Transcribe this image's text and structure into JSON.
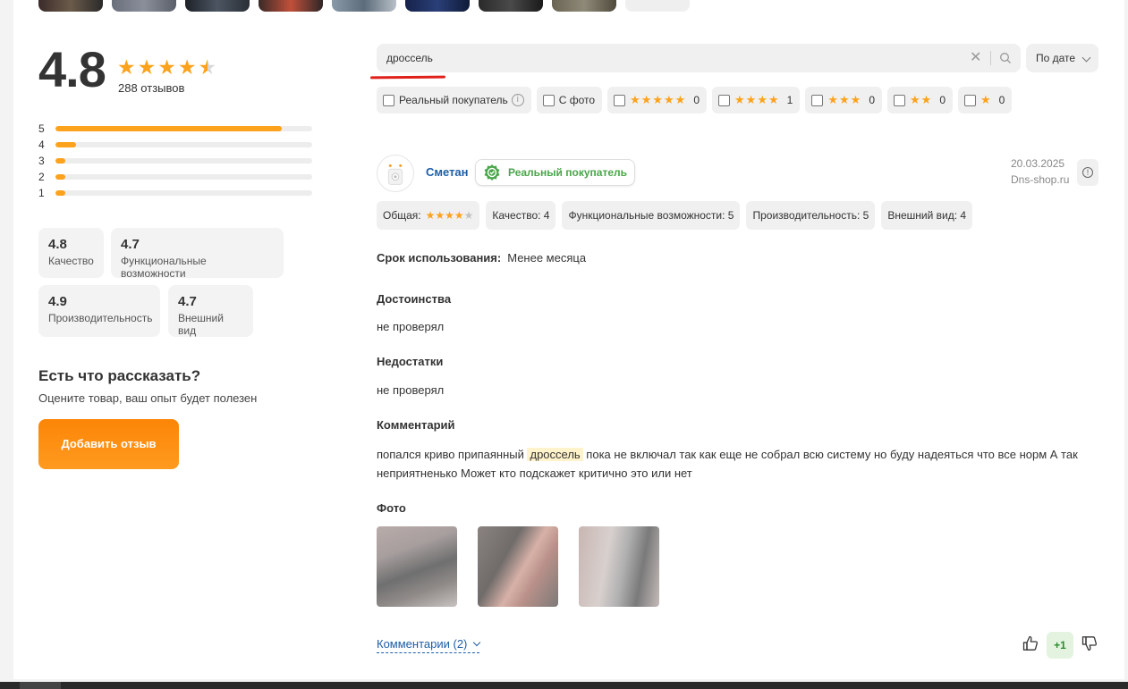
{
  "summary": {
    "average": "4.8",
    "stars_value": 4.8,
    "reviews_count": "288 отзывов",
    "distribution": [
      {
        "label": "5",
        "share": 0.88
      },
      {
        "label": "4",
        "share": 0.08
      },
      {
        "label": "3",
        "share": 0.04
      },
      {
        "label": "2",
        "share": 0.04
      },
      {
        "label": "1",
        "share": 0.04
      }
    ],
    "criteria": [
      {
        "value": "4.8",
        "label": "Качество"
      },
      {
        "value": "4.7",
        "label": "Функциональные возможности"
      },
      {
        "value": "4.9",
        "label": "Производительность"
      },
      {
        "value": "4.7",
        "label": "Внешний вид"
      }
    ]
  },
  "cta": {
    "title": "Есть что рассказать?",
    "subtitle": "Оцените товар, ваш опыт будет полезен",
    "button": "Добавить отзыв"
  },
  "search": {
    "value": "дроссель",
    "sort_label": "По дате"
  },
  "filters": {
    "real_buyer": "Реальный покупатель",
    "with_photo": "С фото",
    "stars": [
      {
        "stars": "★★★★★",
        "count": "0"
      },
      {
        "stars": "★★★★",
        "count": "1"
      },
      {
        "stars": "★★★",
        "count": "0"
      },
      {
        "stars": "★★",
        "count": "0"
      },
      {
        "stars": "★",
        "count": "0"
      }
    ]
  },
  "review": {
    "author": "Сметан",
    "badge": "Реальный покупатель",
    "date": "20.03.2025",
    "source": "Dns-shop.ru",
    "overall_label": "Общая:",
    "overall_stars": 4,
    "ratings": [
      "Качество: 4",
      "Функциональные возможности: 5",
      "Производительность: 5",
      "Внешний вид: 4"
    ],
    "usage_label": "Срок использования:",
    "usage_value": "Менее месяца",
    "pros_title": "Достоинства",
    "pros": "не проверял",
    "cons_title": "Недостатки",
    "cons": "не проверял",
    "comment_title": "Комментарий",
    "comment_before": "попался криво припаянный ",
    "comment_highlight": "дроссель",
    "comment_after": " пока не включал так как еще не собрал всю систему но буду надеяться что все норм А так неприятненько Может кто подскажет критично это или нет",
    "photos_title": "Фото",
    "comments_link": "Комментарии (2)",
    "score": "+1"
  },
  "colors": {
    "accent": "#fca21c",
    "link": "#1e5ea8",
    "verified": "#4aa64a",
    "button": "#fc8507",
    "underline": "#e0201a"
  }
}
